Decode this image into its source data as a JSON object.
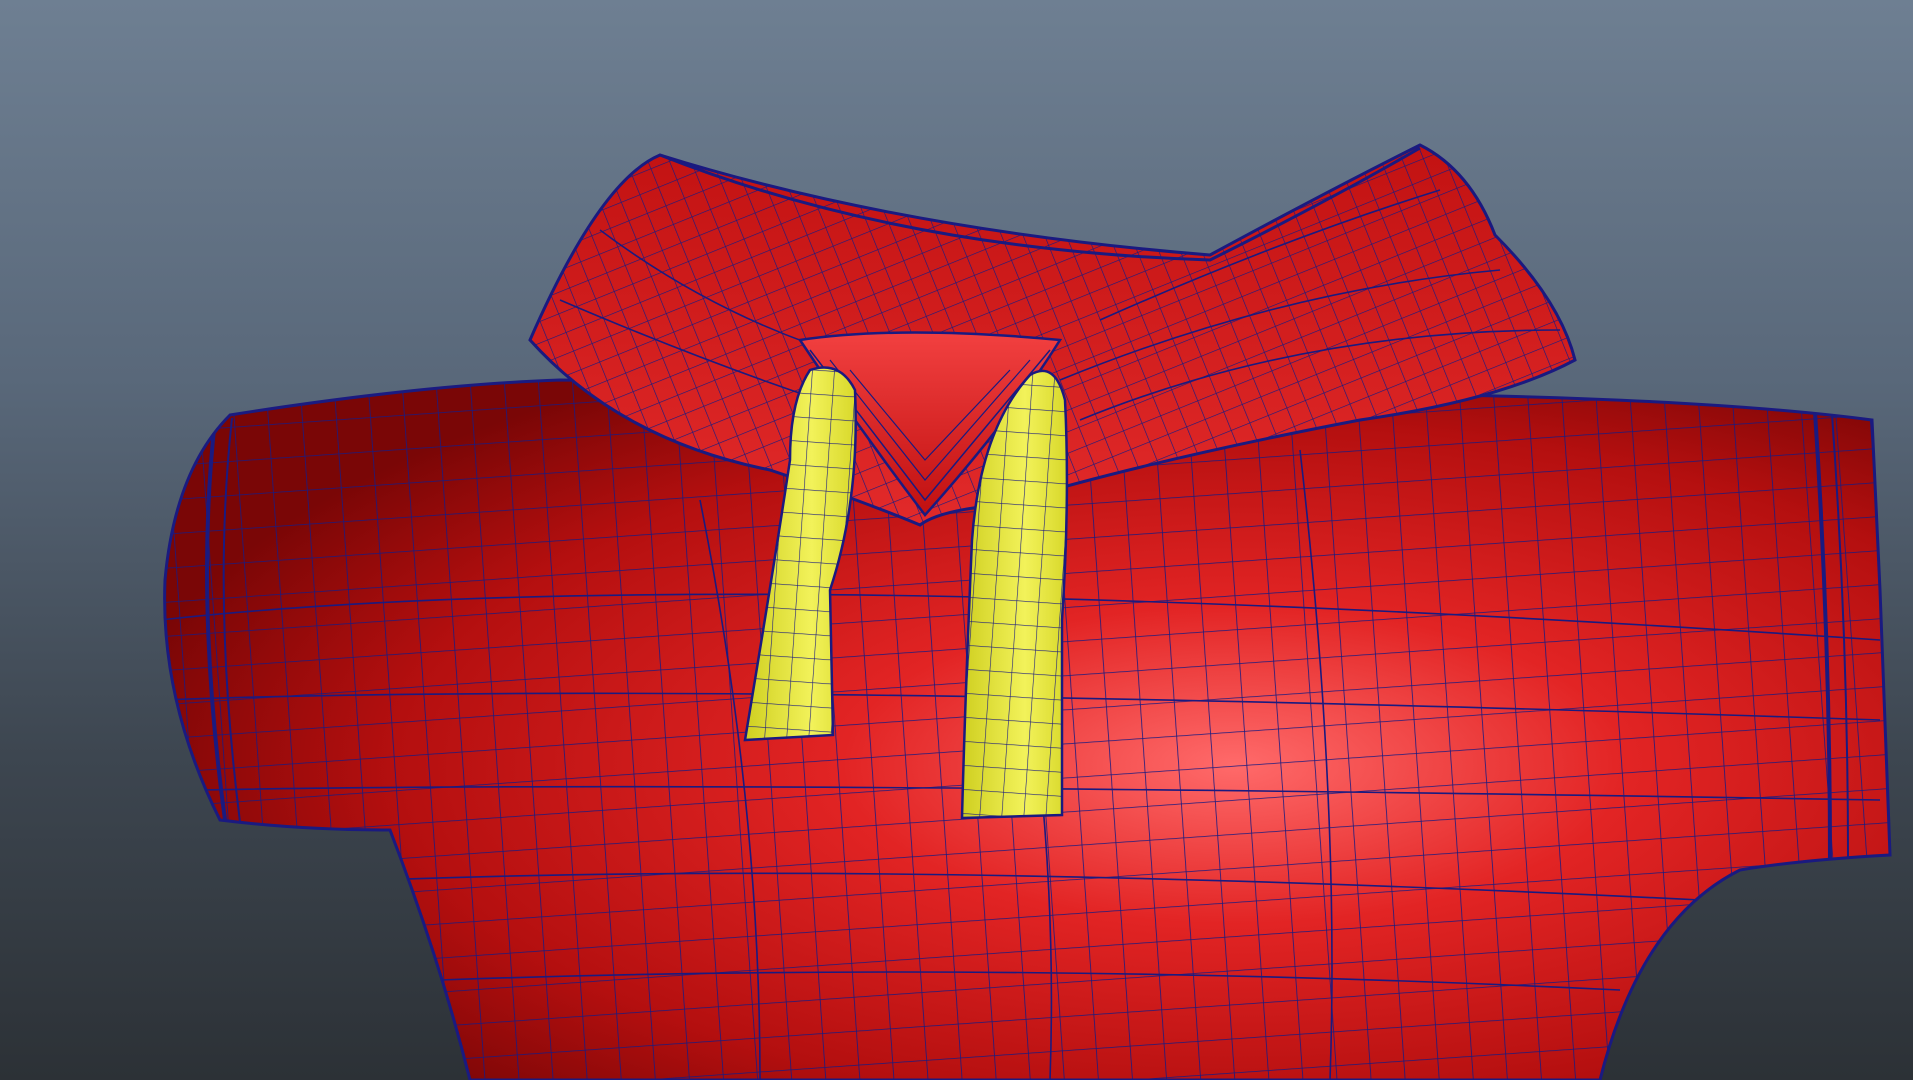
{
  "viewport": {
    "background_top": "#6e7f92",
    "background_bottom": "#2c3136"
  },
  "model": {
    "shirt_color": "#d81414",
    "drawstring_color": "#e8e838",
    "wireframe_color": "#1a1a80"
  }
}
